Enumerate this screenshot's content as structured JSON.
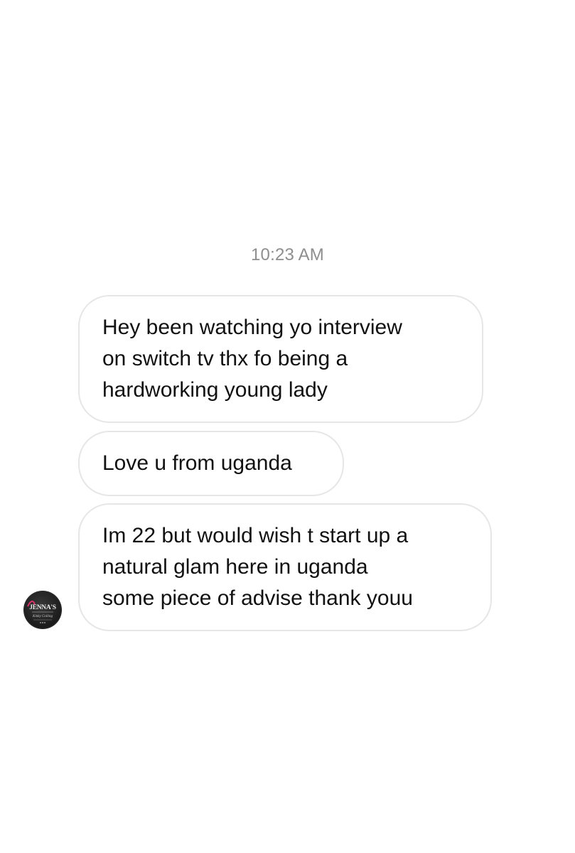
{
  "thread": {
    "timestamp": "10:23 AM",
    "messages": [
      {
        "lines": [
          "Hey been watching yo interview",
          "on switch tv thx fo being a",
          "hardworking young lady"
        ]
      },
      {
        "lines": [
          "Love u from uganda"
        ]
      },
      {
        "lines": [
          "Im 22 but would wish t start up a",
          "natural glam here in uganda",
          "some piece of advise thank youu"
        ]
      }
    ]
  },
  "sender": {
    "avatar_logo_text": "JENNA'S",
    "avatar_logo_script": "Kinky Coiling",
    "avatar_logo_accent": "#d6336c"
  }
}
